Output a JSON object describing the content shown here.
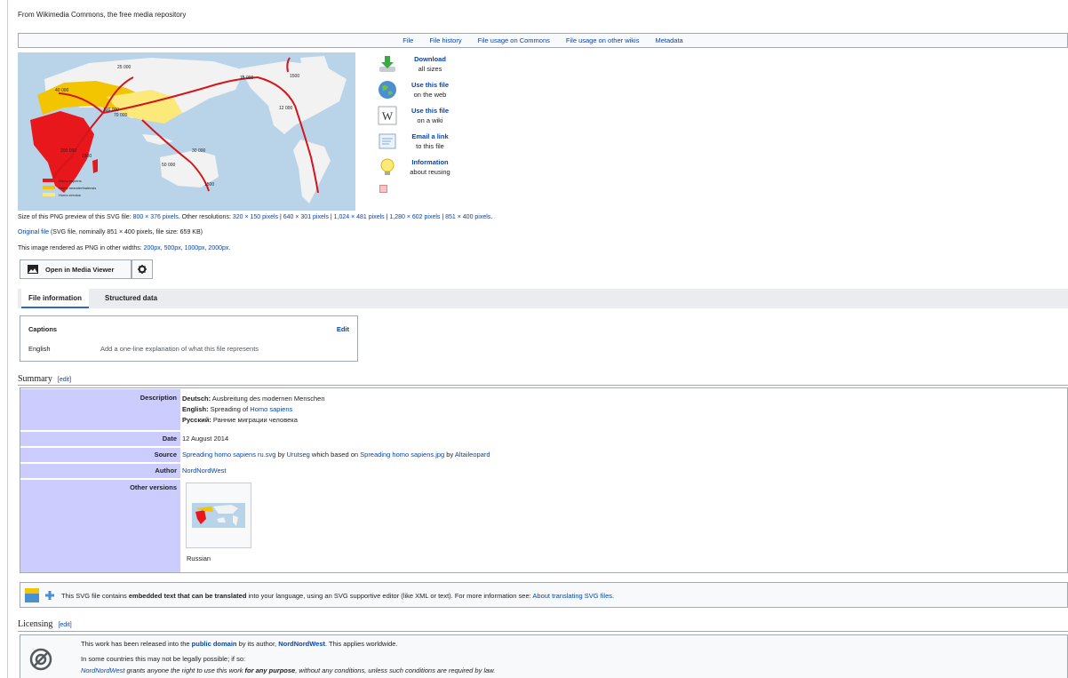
{
  "from_line": "From Wikimedia Commons, the free media repository",
  "file_tabs": [
    "File",
    "File history",
    "File usage on Commons",
    "File usage on other wikis",
    "Metadata"
  ],
  "map": {
    "labels": [
      "25 000",
      "40 000",
      "70 000",
      "100 000",
      "15 000",
      "12 000",
      "200 000",
      "1500",
      "50 000",
      "30 000",
      "1500",
      "1500"
    ],
    "legend": [
      "Homo sapiens",
      "Homo neanderthalensis",
      "Homo erectus"
    ],
    "colors": {
      "ocean": "#b9d3e8",
      "land": "#f2f2f2",
      "sapiens": "#e8171b",
      "neanderthal": "#f3c400",
      "erectus": "#fbe97a",
      "arrow": "#d3161b"
    }
  },
  "share": [
    {
      "icon": "download-icon",
      "title": "Download",
      "sub": "all sizes"
    },
    {
      "icon": "globe-icon",
      "title": "Use this file",
      "sub": "on the web"
    },
    {
      "icon": "wikipedia-icon",
      "title": "Use this file",
      "sub": "on a wiki"
    },
    {
      "icon": "email-icon",
      "title": "Email a link",
      "sub": "to this file"
    },
    {
      "icon": "lightbulb-icon",
      "title": "Information",
      "sub": "about reusing"
    }
  ],
  "preview": {
    "prefix": "Size of this PNG preview of this SVG file: ",
    "size": "800 × 376 pixels",
    "other": ". Other resolutions: ",
    "res1": "320 × 150 pixels",
    "res2": "640 × 301 pixels",
    "res3": "1,024 × 481 pixels",
    "res4": "1,280 × 602 pixels",
    "res5": "851 × 400 pixels",
    "sep": " | ",
    "end": "."
  },
  "original": {
    "link": "Original file",
    "text": " (SVG file, nominally 851 × 400 pixels, file size: 659 KB)"
  },
  "widths": {
    "prefix": "This image rendered as PNG in other widths: ",
    "w1": "200px",
    "w2": "500px",
    "w3": "1000px",
    "w4": "2000px",
    "comma": ", ",
    "end": "."
  },
  "media_viewer_label": "Open in Media Viewer",
  "info_tabs": {
    "file_information": "File information",
    "structured_data": "Structured data"
  },
  "captions": {
    "heading": "Captions",
    "edit": "Edit",
    "lang": "English",
    "placeholder": "Add a one-line explanation of what this file represents"
  },
  "summary": {
    "heading": "Summary",
    "edit": "edit",
    "description_label": "Description",
    "desc_de_lang": "Deutsch:",
    "desc_de": " Ausbreitung des modernen Menschen",
    "desc_en_lang": "English:",
    "desc_en": " Spreading of ",
    "desc_en_link": "Homo sapiens",
    "desc_ru_lang": "Русский:",
    "desc_ru": " Ранние миграции человека",
    "date_label": "Date",
    "date": "12 August 2014",
    "source_label": "Source",
    "source_link1": "Spreading homo sapiens ru.svg",
    "source_by": " by ",
    "source_user1": "Urutseg",
    "source_mid": " which based on ",
    "source_link2": "Spreading homo sapiens.jpg",
    "source_user2": "Altaileopard",
    "author_label": "Author",
    "author": "NordNordWest",
    "other_versions_label": "Other versions",
    "other_version_caption": "Russian"
  },
  "translate_note": {
    "pre": "This SVG file contains ",
    "bold": "embedded text that can be translated",
    "mid": " into your language, using an SVG supportive editor (like XML or text). For more information see: ",
    "link": "About translating SVG files",
    "end": "."
  },
  "licensing": {
    "heading": "Licensing",
    "edit": "edit",
    "l1_pre": "This work has been released into the ",
    "l1_link": "public domain",
    "l1_mid": " by its author, ",
    "l1_author": "NordNordWest",
    "l1_end": ". This applies worldwide.",
    "l2": "In some countries this may not be legally possible; if so:",
    "l3_author": "NordNordWest",
    "l3_mid": " grants anyone the right to use this work ",
    "l3_bold": "for any purpose",
    "l3_end": ", without any conditions, unless such conditions are required by law."
  }
}
